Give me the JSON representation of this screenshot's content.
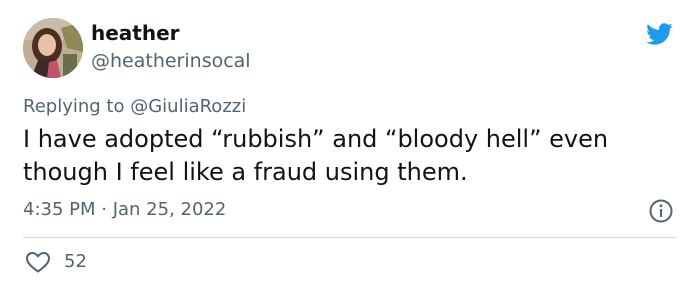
{
  "tweet": {
    "display_name": "heather",
    "handle": "@heatherinsocal",
    "replying_prefix": "Replying to",
    "replying_to": "@GiuliaRozzi",
    "text": "I have adopted “rubbish” and “bloody hell” even though I feel like a fraud using them.",
    "timestamp": "4:35 PM · Jan 25, 2022",
    "like_count": "52"
  },
  "icons": {
    "brand": "twitter-bird-icon",
    "info": "info-icon",
    "like": "heart-icon"
  },
  "colors": {
    "brand_blue": "#1d9bf0",
    "text_primary": "#0f1419",
    "text_secondary": "#536471",
    "divider": "#cfd9de"
  }
}
